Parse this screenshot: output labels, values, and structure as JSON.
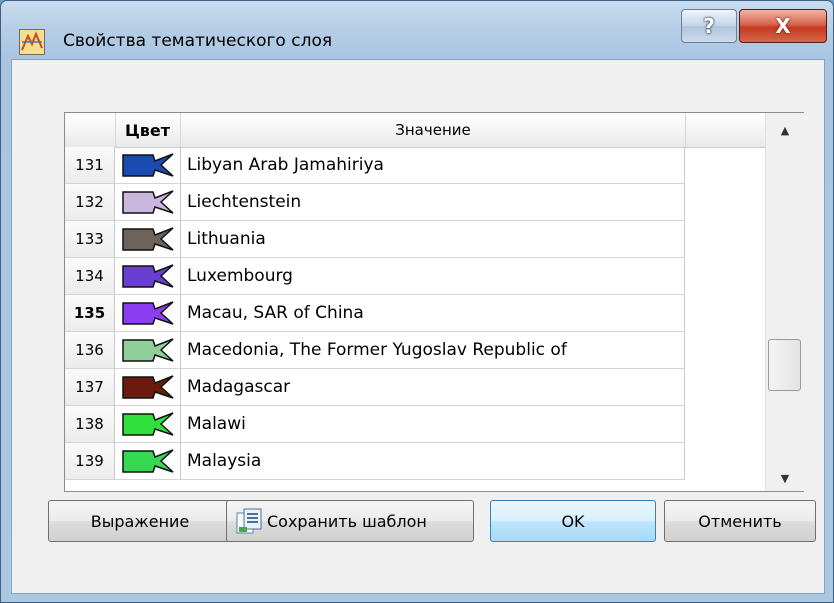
{
  "window": {
    "title": "Свойства тематического слоя",
    "help_label": "?",
    "close_label": "X"
  },
  "table": {
    "headers": {
      "color": "Цвет",
      "value": "Значение"
    },
    "rows": [
      {
        "num": "131",
        "value": "Libyan Arab Jamahiriya",
        "color": "#1a4bb0"
      },
      {
        "num": "132",
        "value": "Liechtenstein",
        "color": "#c9b7e0"
      },
      {
        "num": "133",
        "value": "Lithuania",
        "color": "#6e635a"
      },
      {
        "num": "134",
        "value": "Luxembourg",
        "color": "#6a3ed1"
      },
      {
        "num": "135",
        "value": "Macau, SAR of China",
        "color": "#8a3ef0",
        "current": true
      },
      {
        "num": "136",
        "value": "Macedonia, The Former Yugoslav Republic of",
        "color": "#8fcf99"
      },
      {
        "num": "137",
        "value": "Madagascar",
        "color": "#6b1a0d"
      },
      {
        "num": "138",
        "value": "Malawi",
        "color": "#2fe03d"
      },
      {
        "num": "139",
        "value": "Malaysia",
        "color": "#35d850"
      }
    ]
  },
  "buttons": {
    "expression": "Выражение",
    "save_template": "Сохранить шаблон",
    "ok": "OK",
    "cancel": "Отменить"
  },
  "icons": {
    "app": "thematic-layer-icon",
    "save": "save-template-icon",
    "scroll_up": "scroll-up-arrow-icon",
    "scroll_down": "scroll-down-arrow-icon"
  }
}
